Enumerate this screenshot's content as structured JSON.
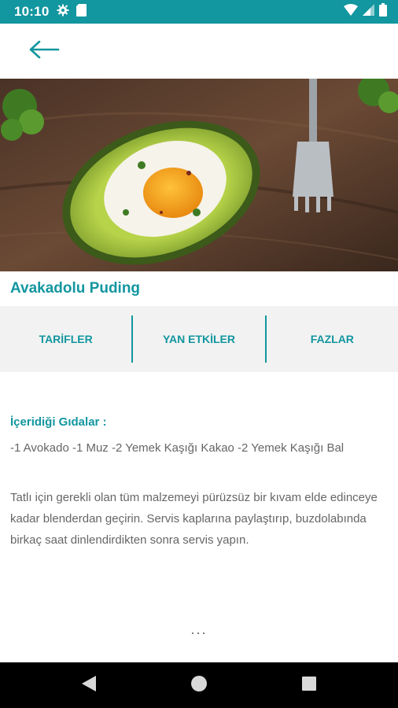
{
  "status_bar": {
    "time": "10:10",
    "background": "#12969f",
    "left_icons": [
      "gear-icon",
      "sd-card-icon"
    ],
    "right_icons": [
      "wifi-icon",
      "cell-signal-icon",
      "battery-icon"
    ]
  },
  "app_bar": {
    "back_icon": "arrow-left-icon"
  },
  "recipe": {
    "title": "Avakadolu Puding",
    "ingredients_heading": "İçeridiği Gıdalar :",
    "ingredients": "-1 Avokado -1 Muz -2 Yemek Kaşığı Kakao -2 Yemek Kaşığı Bal",
    "instructions": "Tatlı için gerekli olan tüm malzemeyi pürüzsüz bir kıvam elde edinceye kadar blenderdan geçirin. Servis kaplarına paylaştırıp, buzdolabında birkaç saat dinlendirdikten sonra servis yapın.",
    "more": "..."
  },
  "tabs": [
    {
      "label": "TARİFLER"
    },
    {
      "label": "YAN ETKİLER"
    },
    {
      "label": "FAZLAR"
    }
  ],
  "nav_bar": {
    "icons": [
      "back-triangle-icon",
      "home-circle-icon",
      "recents-square-icon"
    ]
  },
  "colors": {
    "accent": "#12969f",
    "body_text": "#666666",
    "tab_background": "#f2f2f2"
  }
}
